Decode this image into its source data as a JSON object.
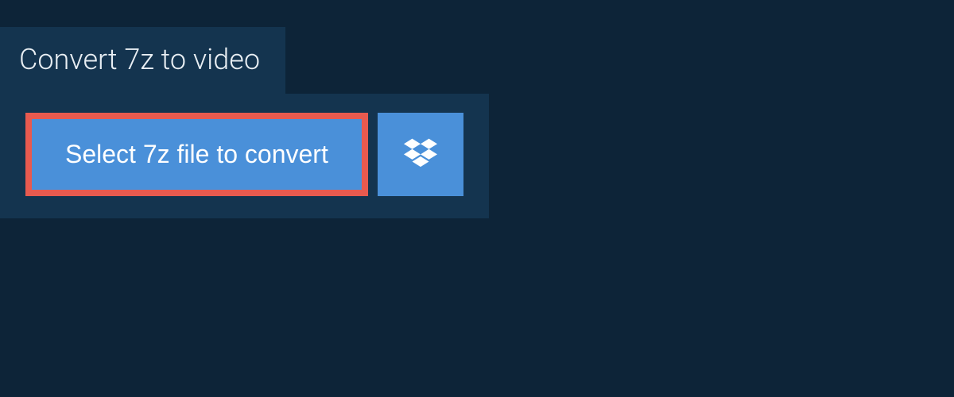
{
  "tab": {
    "title": "Convert 7z to video"
  },
  "actions": {
    "select_label": "Select 7z file to convert"
  }
}
